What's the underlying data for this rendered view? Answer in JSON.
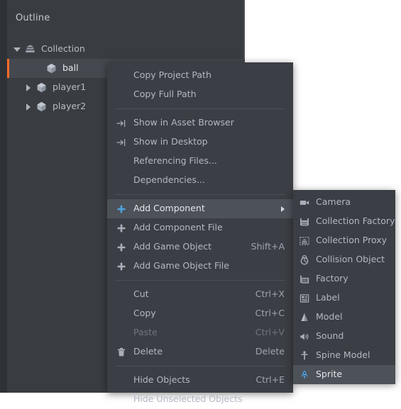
{
  "theme": {
    "panel_bg": "#393c41",
    "menu_bg": "#3b3e44",
    "menu_highlight": "#4d5158",
    "text": "#b2b8c4",
    "text_bright": "#e4e7ec",
    "text_disabled": "#6f747d",
    "accent_orange": "#ff6b28",
    "accent_blue": "#4ea3e0",
    "separator": "#4b4f56",
    "canvas_white": "#ffffff"
  },
  "outline": {
    "title": "Outline",
    "items": [
      {
        "label": "Collection",
        "icon": "collection-icon",
        "depth": 0,
        "twisty": "open",
        "selected": false
      },
      {
        "label": "ball",
        "icon": "game-object-icon",
        "depth": 2,
        "twisty": "none",
        "selected": true
      },
      {
        "label": "player1",
        "icon": "game-object-icon",
        "depth": 1,
        "twisty": "closed",
        "selected": false
      },
      {
        "label": "player2",
        "icon": "game-object-icon",
        "depth": 1,
        "twisty": "closed",
        "selected": false
      }
    ]
  },
  "context_menu": {
    "groups": [
      {
        "items": [
          {
            "label": "Copy Project Path",
            "icon": null,
            "accel": "",
            "disabled": false,
            "highlight": false,
            "submenu": false
          },
          {
            "label": "Copy Full Path",
            "icon": null,
            "accel": "",
            "disabled": false,
            "highlight": false,
            "submenu": false
          }
        ]
      },
      {
        "items": [
          {
            "label": "Show in Asset Browser",
            "icon": "show-in-arrow-icon",
            "accel": "",
            "disabled": false,
            "highlight": false,
            "submenu": false
          },
          {
            "label": "Show in Desktop",
            "icon": "show-in-arrow-icon",
            "accel": "",
            "disabled": false,
            "highlight": false,
            "submenu": false
          },
          {
            "label": "Referencing Files...",
            "icon": null,
            "accel": "",
            "disabled": false,
            "highlight": false,
            "submenu": false
          },
          {
            "label": "Dependencies...",
            "icon": null,
            "accel": "",
            "disabled": false,
            "highlight": false,
            "submenu": false
          }
        ]
      },
      {
        "items": [
          {
            "label": "Add Component",
            "icon": "plus-icon-blue",
            "accel": "",
            "disabled": false,
            "highlight": true,
            "submenu": true
          },
          {
            "label": "Add Component File",
            "icon": "plus-icon",
            "accel": "",
            "disabled": false,
            "highlight": false,
            "submenu": false
          },
          {
            "label": "Add Game Object",
            "icon": "plus-icon",
            "accel": "Shift+A",
            "disabled": false,
            "highlight": false,
            "submenu": false
          },
          {
            "label": "Add Game Object File",
            "icon": "plus-icon",
            "accel": "",
            "disabled": false,
            "highlight": false,
            "submenu": false
          }
        ]
      },
      {
        "items": [
          {
            "label": "Cut",
            "icon": null,
            "accel": "Ctrl+X",
            "disabled": false,
            "highlight": false,
            "submenu": false
          },
          {
            "label": "Copy",
            "icon": null,
            "accel": "Ctrl+C",
            "disabled": false,
            "highlight": false,
            "submenu": false
          },
          {
            "label": "Paste",
            "icon": null,
            "accel": "Ctrl+V",
            "disabled": true,
            "highlight": false,
            "submenu": false
          },
          {
            "label": "Delete",
            "icon": "trash-icon",
            "accel": "Delete",
            "disabled": false,
            "highlight": false,
            "submenu": false
          }
        ]
      },
      {
        "items": [
          {
            "label": "Hide Objects",
            "icon": null,
            "accel": "Ctrl+E",
            "disabled": false,
            "highlight": false,
            "submenu": false
          },
          {
            "label": "Hide Unselected Objects",
            "icon": null,
            "accel": "",
            "disabled": false,
            "highlight": false,
            "submenu": false
          }
        ]
      }
    ]
  },
  "submenu": {
    "title": "Add Component",
    "items": [
      {
        "label": "Camera",
        "icon": "camera-icon",
        "highlight": false
      },
      {
        "label": "Collection Factory",
        "icon": "collection-factory-icon",
        "highlight": false
      },
      {
        "label": "Collection Proxy",
        "icon": "collection-proxy-icon",
        "highlight": false
      },
      {
        "label": "Collision Object",
        "icon": "collision-object-icon",
        "highlight": false
      },
      {
        "label": "Factory",
        "icon": "factory-icon",
        "highlight": false
      },
      {
        "label": "Label",
        "icon": "label-icon",
        "highlight": false
      },
      {
        "label": "Model",
        "icon": "model-icon",
        "highlight": false
      },
      {
        "label": "Sound",
        "icon": "sound-icon",
        "highlight": false
      },
      {
        "label": "Spine Model",
        "icon": "spine-model-icon",
        "highlight": false
      },
      {
        "label": "Sprite",
        "icon": "sprite-icon",
        "highlight": true
      }
    ]
  }
}
